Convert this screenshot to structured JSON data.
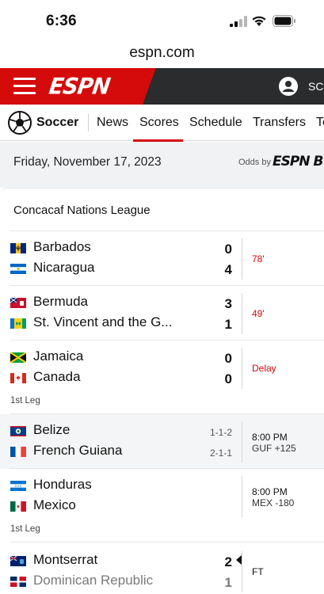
{
  "status_bar": {
    "time": "6:36"
  },
  "browser": {
    "url": "espn.com"
  },
  "header": {
    "logo": "ESPN",
    "user_label": "SC"
  },
  "nav": {
    "sport": "Soccer",
    "tabs": [
      "News",
      "Scores",
      "Schedule",
      "Transfers",
      "Te"
    ],
    "active_tab": "Scores"
  },
  "date_bar": {
    "date": "Friday, November 17, 2023",
    "odds_label": "Odds by",
    "odds_logo": "ESPN B"
  },
  "league": "Concacaf Nations League",
  "colors": {
    "accent": "#d50a0a",
    "header_bg": "#2b2c2d",
    "nav_bg": "#ffffff",
    "date_bg": "#f1f2f4"
  },
  "games": [
    {
      "team1": {
        "name": "Barbados",
        "score": "0",
        "flag": "barbados-flag"
      },
      "team2": {
        "name": "Nicaragua",
        "score": "4",
        "flag": "nicaragua-flag"
      },
      "status": "78'",
      "status_type": "live"
    },
    {
      "team1": {
        "name": "Bermuda",
        "score": "3",
        "flag": "bermuda-flag"
      },
      "team2": {
        "name": "St. Vincent and the G...",
        "score": "1",
        "flag": "st-vincent-flag"
      },
      "status": "49'",
      "status_type": "live"
    },
    {
      "team1": {
        "name": "Jamaica",
        "score": "0",
        "flag": "jamaica-flag"
      },
      "team2": {
        "name": "Canada",
        "score": "0",
        "flag": "canada-flag"
      },
      "status": "Delay",
      "status_type": "live",
      "note": "1st Leg"
    },
    {
      "team1": {
        "name": "Belize",
        "record": "1-1-2",
        "flag": "belize-flag"
      },
      "team2": {
        "name": "French Guiana",
        "record": "2-1-1",
        "flag": "french-guiana-flag"
      },
      "status": "8:00 PM",
      "status_sub": "GUF +125",
      "status_type": "scheduled"
    },
    {
      "team1": {
        "name": "Honduras",
        "flag": "honduras-flag"
      },
      "team2": {
        "name": "Mexico",
        "flag": "mexico-flag"
      },
      "status": "8:00 PM",
      "status_sub": "MEX -180",
      "status_type": "scheduled",
      "note": "1st Leg"
    },
    {
      "team1": {
        "name": "Montserrat",
        "score": "2",
        "flag": "montserrat-flag",
        "winner": true
      },
      "team2": {
        "name": "Dominican Republic",
        "score": "1",
        "flag": "dominican-republic-flag"
      },
      "status": "FT",
      "status_type": "final"
    }
  ]
}
